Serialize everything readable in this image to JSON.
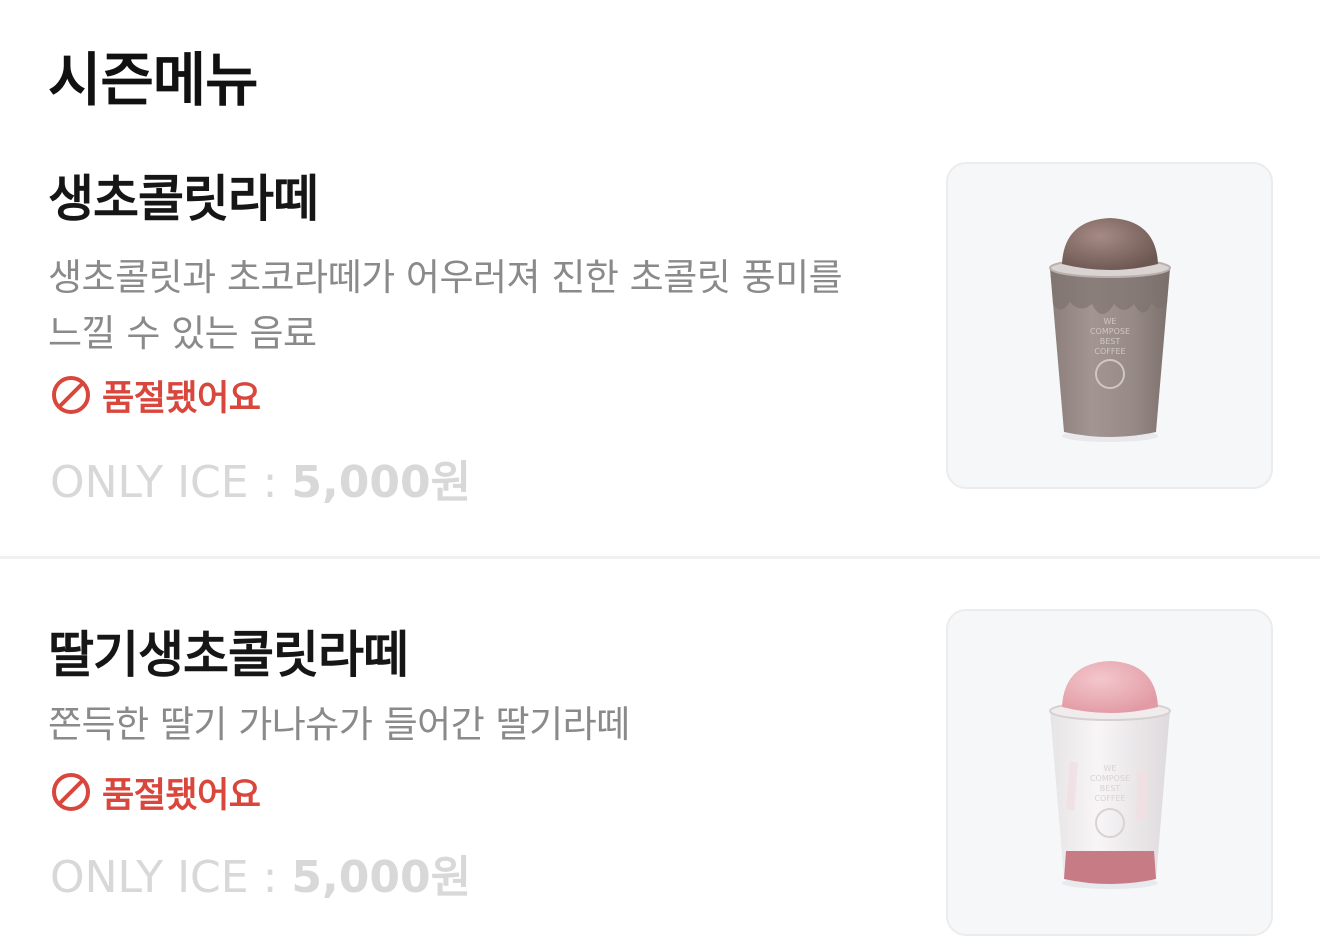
{
  "section": {
    "title": "시즌메뉴"
  },
  "items": [
    {
      "name": "생초콜릿라떼",
      "description": "생초콜릿과 초코라떼가 어우러져 진한 초콜릿 풍미를\n느낄 수 있는 음료",
      "status": "품절됐어요",
      "price_prefix": "ONLY ICE : ",
      "price_value": "5,000원",
      "image_icon": "chocolate-latte-cup-icon"
    },
    {
      "name": "딸기생초콜릿라떼",
      "description": "쫀득한 딸기 가나슈가 들어간 딸기라떼",
      "status": "품절됐어요",
      "price_prefix": "ONLY ICE : ",
      "price_value": "5,000원",
      "image_icon": "strawberry-latte-cup-icon"
    }
  ],
  "colors": {
    "soldout": "#d9463b",
    "price_disabled": "#d8d8d8",
    "description": "#8a8a8a"
  }
}
